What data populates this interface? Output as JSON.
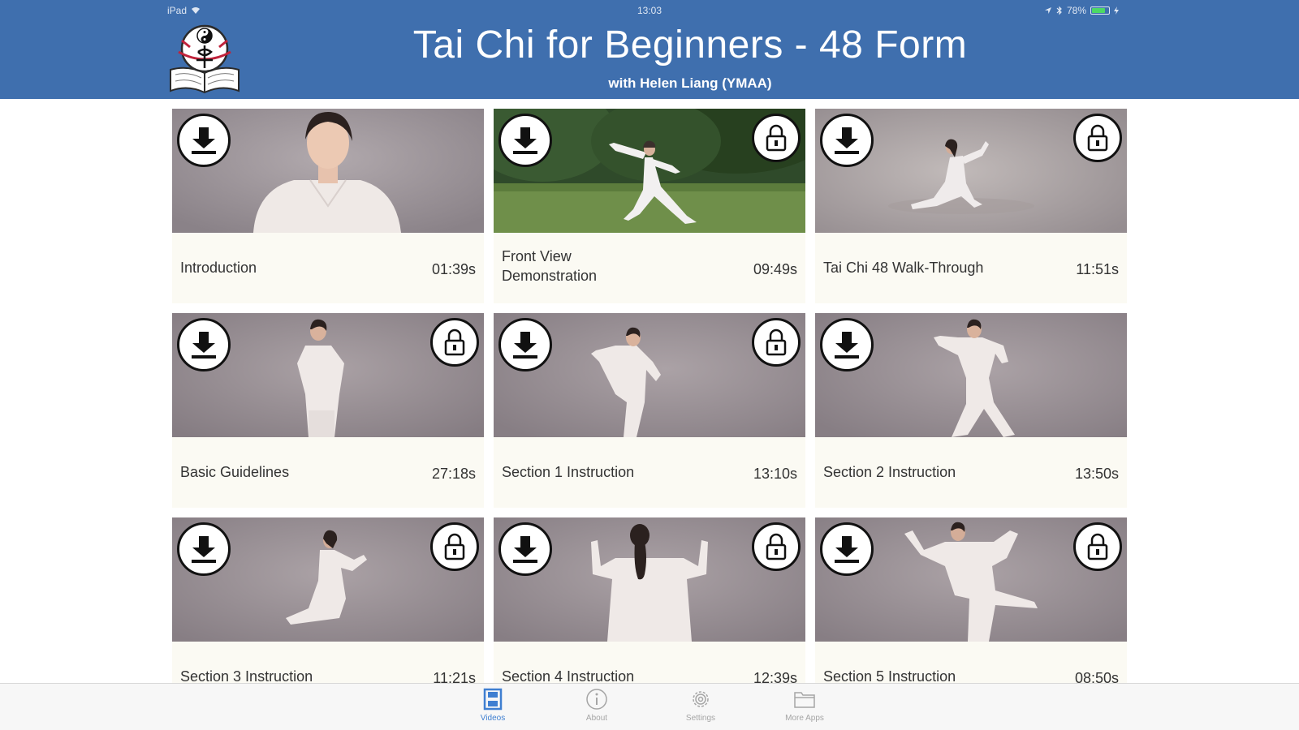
{
  "status_bar": {
    "device": "iPad",
    "time": "13:03",
    "battery": "78%",
    "battery_level": 0.78
  },
  "header": {
    "title": "Tai Chi for Beginners - 48 Form",
    "subtitle": "with Helen Liang (YMAA)",
    "logo_icon": "ymaa-yin-yang-book-logo-icon"
  },
  "videos": [
    {
      "title": "Introduction",
      "duration": "01:39s",
      "locked": false
    },
    {
      "title": "Front View Demonstration",
      "duration": "09:49s",
      "locked": true
    },
    {
      "title": "Tai Chi 48 Walk-Through",
      "duration": "11:51s",
      "locked": true
    },
    {
      "title": "Basic Guidelines",
      "duration": "27:18s",
      "locked": true
    },
    {
      "title": "Section 1 Instruction",
      "duration": "13:10s",
      "locked": true
    },
    {
      "title": "Section 2 Instruction",
      "duration": "13:50s",
      "locked": true
    },
    {
      "title": "Section 3 Instruction",
      "duration": "11:21s",
      "locked": true
    },
    {
      "title": "Section 4 Instruction",
      "duration": "12:39s",
      "locked": true
    },
    {
      "title": "Section 5 Instruction",
      "duration": "08:50s",
      "locked": true
    }
  ],
  "tabs": [
    {
      "label": "Videos",
      "icon": "film-icon",
      "active": true
    },
    {
      "label": "About",
      "icon": "info-icon",
      "active": false
    },
    {
      "label": "Settings",
      "icon": "gear-icon",
      "active": false
    },
    {
      "label": "More Apps",
      "icon": "folder-icon",
      "active": false
    }
  ],
  "colors": {
    "header_bg": "#3f6fae",
    "active_tab": "#3f7fd1",
    "card_bg": "#fbfaf3"
  }
}
